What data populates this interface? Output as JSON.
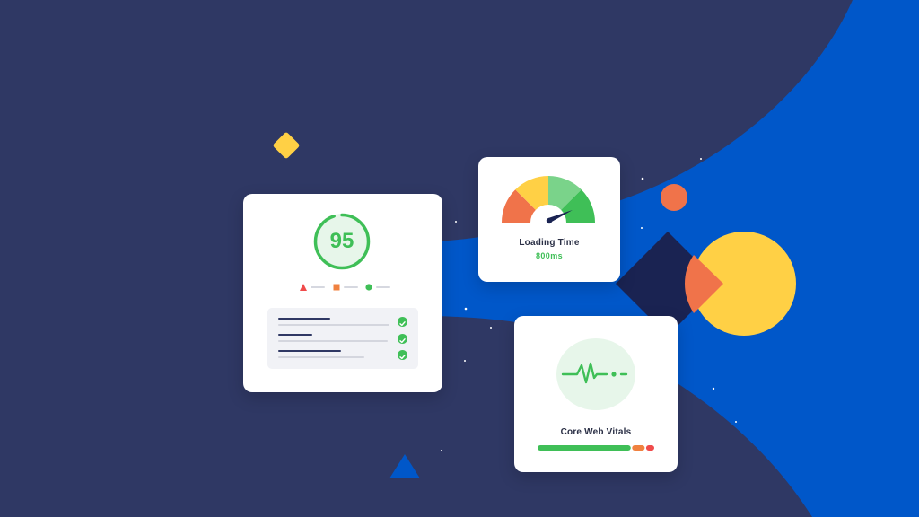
{
  "score_card": {
    "score": "95",
    "score_fraction": 0.95,
    "audit_rows": [
      {
        "status": "pass"
      },
      {
        "status": "pass"
      },
      {
        "status": "pass"
      }
    ]
  },
  "loading_card": {
    "title": "Loading Time",
    "value": "800ms"
  },
  "vitals_card": {
    "title": "Core Web Vitals",
    "bar_segments": [
      {
        "fraction": 0.81,
        "color": "#3fbf57"
      },
      {
        "fraction": 0.12,
        "color": "#f0813f"
      },
      {
        "fraction": 0.07,
        "color": "#f04b4b"
      }
    ]
  },
  "colors": {
    "background": "#2f3864",
    "blue": "#0057c9",
    "green": "#3fbf57",
    "light_green": "#7ad38a",
    "yellow": "#ffd045",
    "orange": "#f0734a",
    "red": "#f04b4b",
    "navy": "#1a2352"
  },
  "icons": {
    "fail": "triangle-icon",
    "average": "square-icon",
    "pass": "circle-icon",
    "check": "check-icon",
    "pulse": "heartbeat-icon",
    "gauge": "speedometer-icon"
  }
}
